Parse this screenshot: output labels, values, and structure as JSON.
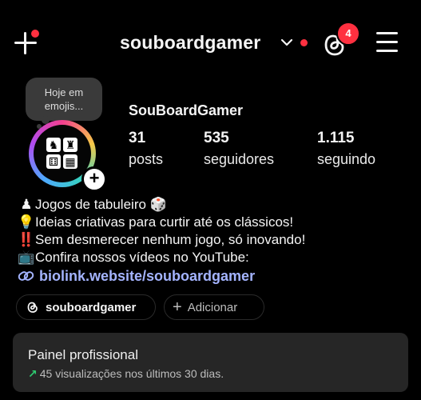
{
  "header": {
    "username": "souboardgamer",
    "notification_count": "4"
  },
  "note": {
    "text": "Hoje em emojis..."
  },
  "profile": {
    "display_name": "SouBoardGamer",
    "stats": [
      {
        "value": "31",
        "label": "posts"
      },
      {
        "value": "535",
        "label": "seguidores"
      },
      {
        "value": "1.115",
        "label": "seguindo"
      }
    ]
  },
  "bio": {
    "lines": [
      {
        "icon": "♟",
        "text": "Jogos de tabuleiro 🎲"
      },
      {
        "icon": "💡",
        "text": "Ideias criativas para curtir até os clássicos!"
      },
      {
        "icon": "‼️",
        "text": "Sem desmerecer nenhum jogo, só inovando!"
      },
      {
        "icon": "📺",
        "text": "Confira nossos vídeos no YouTube:"
      }
    ],
    "link": "biolink.website/souboardgamer"
  },
  "chips": {
    "threads_label": "souboardgamer",
    "add_label": "Adicionar"
  },
  "panel": {
    "title": "Painel profissional",
    "subtitle": "45 visualizações nos últimos 30 dias."
  },
  "colors": {
    "background": "#000000",
    "notification": "#ff3040",
    "link": "#a4b4ff",
    "panel": "#262626",
    "trend_up": "#2ecc71"
  },
  "icons": [
    "plus-icon",
    "chevron-down-icon",
    "threads-icon",
    "menu-icon",
    "link-icon"
  ]
}
